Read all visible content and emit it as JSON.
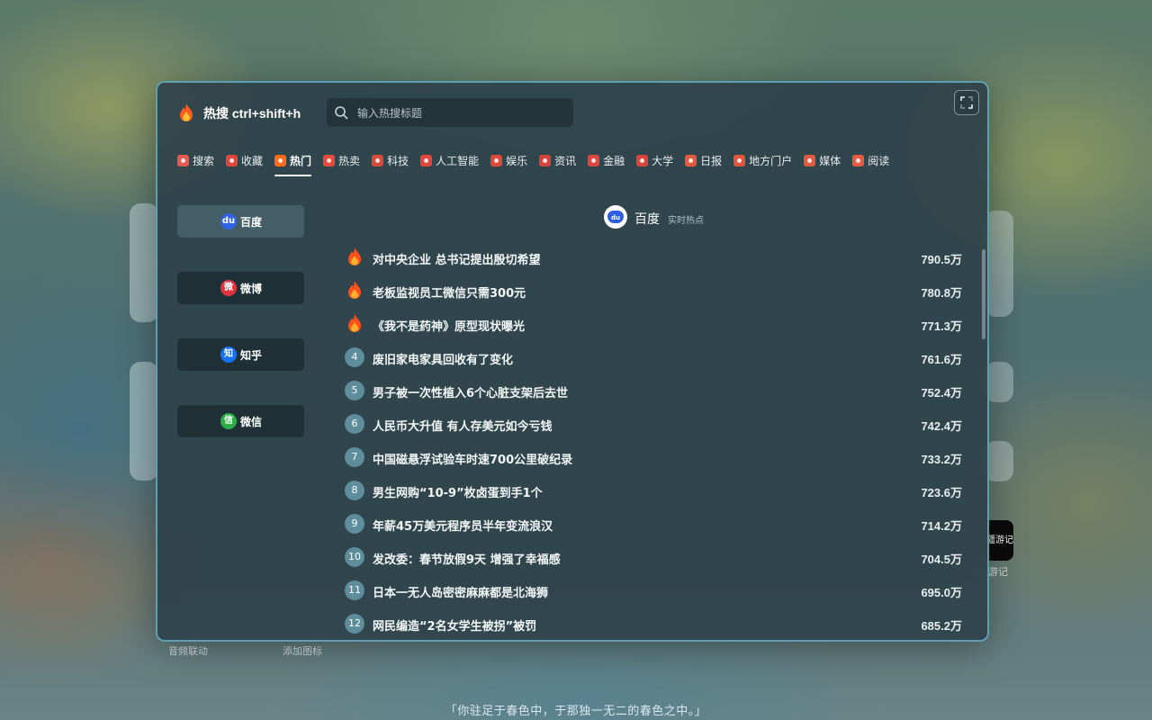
{
  "header": {
    "title": "热搜 ctrl+shift+h",
    "search_placeholder": "输入热搜标题"
  },
  "tabs": [
    {
      "label": "搜索",
      "color": "#e85a4f"
    },
    {
      "label": "收藏",
      "color": "#e0473c"
    },
    {
      "label": "热门",
      "color": "#ff6a1a",
      "active": true
    },
    {
      "label": "热卖",
      "color": "#e84b3c"
    },
    {
      "label": "科技",
      "color": "#d94a3a"
    },
    {
      "label": "人工智能",
      "color": "#e0483b"
    },
    {
      "label": "娱乐",
      "color": "#e0483b"
    },
    {
      "label": "资讯",
      "color": "#d9443a"
    },
    {
      "label": "金融",
      "color": "#e0473c"
    },
    {
      "label": "大学",
      "color": "#d9453b"
    },
    {
      "label": "日报",
      "color": "#e35a40"
    },
    {
      "label": "地方门户",
      "color": "#e2553c"
    },
    {
      "label": "媒体",
      "color": "#e45a3f"
    },
    {
      "label": "阅读",
      "color": "#e55b40"
    }
  ],
  "sidebar": [
    {
      "label": "百度",
      "icon_text": "du",
      "icon_color": "#3063e6",
      "active": true
    },
    {
      "label": "微博",
      "icon_text": "微",
      "icon_color": "#e3333c"
    },
    {
      "label": "知乎",
      "icon_text": "知",
      "icon_color": "#1772f6"
    },
    {
      "label": "微信",
      "icon_text": "信",
      "icon_color": "#2aae45"
    }
  ],
  "content": {
    "source_title": "百度",
    "source_subtitle": "实时热点"
  },
  "items": [
    {
      "rank": "1",
      "title": "对中央企业 总书记提出殷切希望",
      "heat": "790.5万",
      "hot": true
    },
    {
      "rank": "2",
      "title": "老板监视员工微信只需300元",
      "heat": "780.8万",
      "hot": true
    },
    {
      "rank": "3",
      "title": "《我不是药神》原型现状曝光",
      "heat": "771.3万",
      "hot": true
    },
    {
      "rank": "4",
      "title": "废旧家电家具回收有了变化",
      "heat": "761.6万"
    },
    {
      "rank": "5",
      "title": "男子被一次性植入6个心脏支架后去世",
      "heat": "752.4万"
    },
    {
      "rank": "6",
      "title": "人民币大升值 有人存美元如今亏钱",
      "heat": "742.4万"
    },
    {
      "rank": "7",
      "title": "中国磁悬浮试验车时速700公里破纪录",
      "heat": "733.2万"
    },
    {
      "rank": "8",
      "title": "男生网购“10-9”枚卤蛋到手1个",
      "heat": "723.6万"
    },
    {
      "rank": "9",
      "title": "年薪45万美元程序员半年变流浪汉",
      "heat": "714.2万"
    },
    {
      "rank": "10",
      "title": "发改委：春节放假9天 增强了幸福感",
      "heat": "704.5万"
    },
    {
      "rank": "11",
      "title": "日本一无人岛密密麻麻都是北海狮",
      "heat": "695.0万"
    },
    {
      "rank": "12",
      "title": "网民编造“2名女学生被拐”被罚",
      "heat": "685.2万"
    }
  ],
  "background": {
    "label_audio": "音频联动",
    "label_add": "添加图标",
    "app_label": "游记",
    "app_badge": "疆游记",
    "quote": "「你驻足于春色中，于那独一无二的春色之中。」"
  }
}
